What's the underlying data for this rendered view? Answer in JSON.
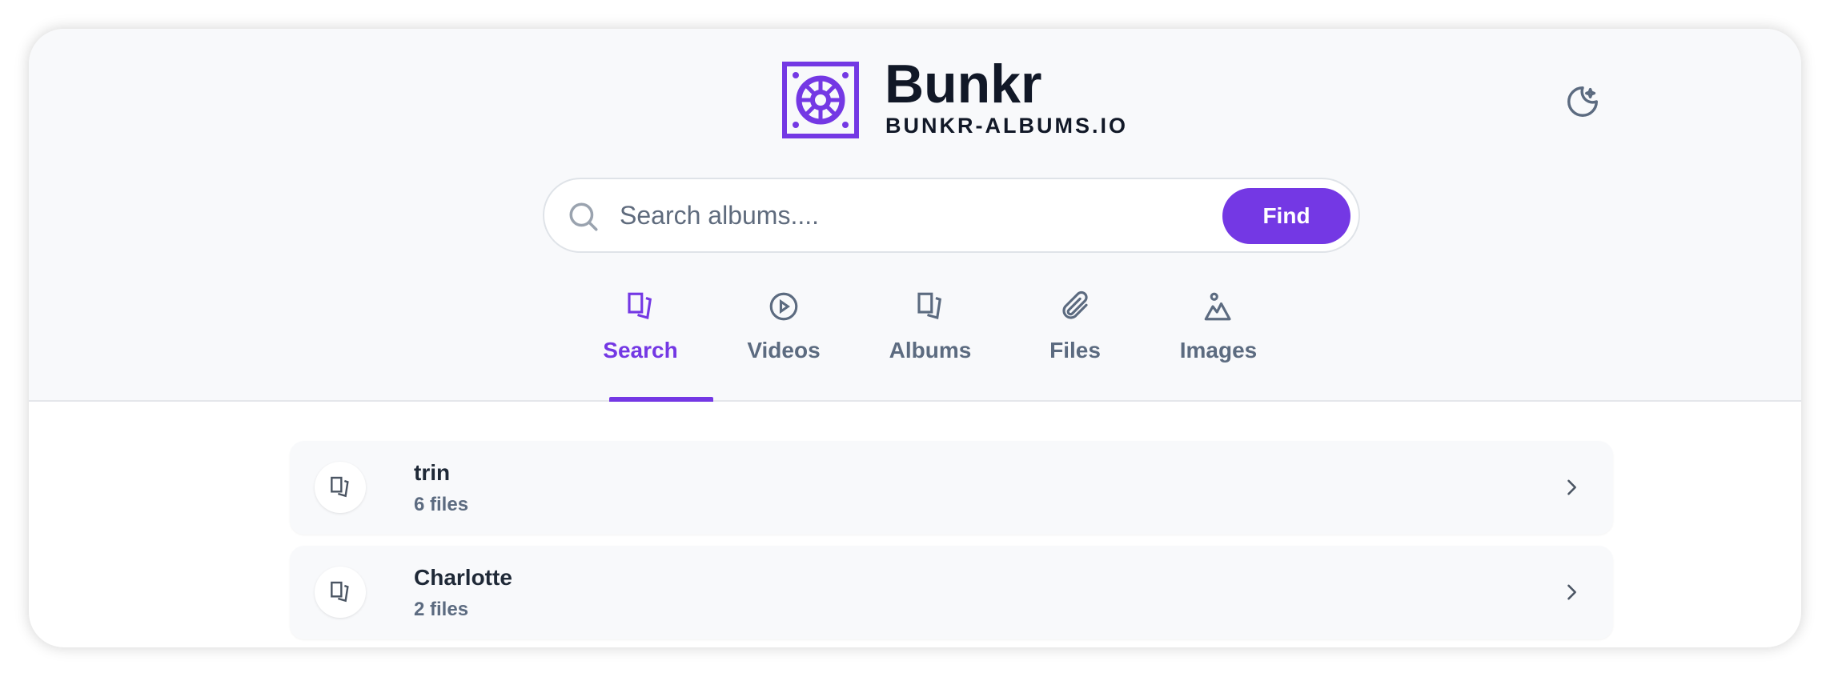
{
  "header": {
    "brand": "Bunkr",
    "domain": "BUNKR-ALBUMS.IO",
    "theme_icon": "moon-sparkle-icon"
  },
  "search": {
    "placeholder": "Search albums....",
    "value": "",
    "button": "Find"
  },
  "tabs": [
    {
      "label": "Search",
      "icon": "albums-icon",
      "active": true
    },
    {
      "label": "Videos",
      "icon": "play-circle-icon",
      "active": false
    },
    {
      "label": "Albums",
      "icon": "albums-icon",
      "active": false
    },
    {
      "label": "Files",
      "icon": "paperclip-icon",
      "active": false
    },
    {
      "label": "Images",
      "icon": "image-icon",
      "active": false
    }
  ],
  "results": [
    {
      "title": "trin",
      "subtitle": "6 files"
    },
    {
      "title": "Charlotte",
      "subtitle": "2 files"
    }
  ],
  "colors": {
    "accent": "#7438e4",
    "text": "#111827",
    "muted": "#5c6b80",
    "header_bg": "#f8f9fb"
  }
}
